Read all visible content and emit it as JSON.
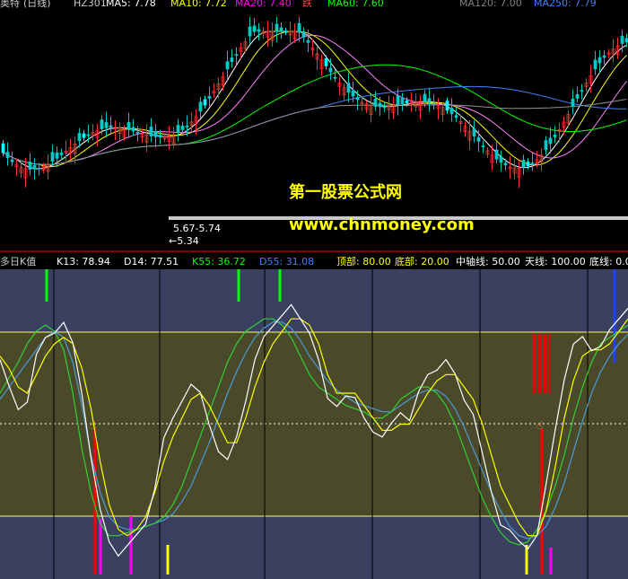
{
  "top_panel": {
    "stock_name": "奥特",
    "period": "(日线)",
    "code": "HZ301",
    "ma_label": "MA5: 7.78",
    "ma10_label": "MA10: 7.72",
    "ma20_label": "MA20: 7.40",
    "extra_label": "跌",
    "ma60_label": "MA60: 7.60",
    "ma120_label": "MA120: 7.00",
    "ma250_label": "MA250: 7.79",
    "annotation_range": "5.67-5.74",
    "annotation_low": "←5.34",
    "watermark_title": "第一股票公式网",
    "watermark_url": "www.chnmoney.com"
  },
  "bottom_panel": {
    "indicator_name": "多日K值",
    "k13": "K13: 78.94",
    "d14": "D14: 77.51",
    "k55": "K55: 36.72",
    "d55": "D55: 31.08",
    "top_label": "顶部: 80.00",
    "bottom_label": "底部: 20.00",
    "mid_label": "中轴线: 50.00",
    "sky_label": "天线: 100.00",
    "floor_label": "底线: 0.0"
  },
  "colors": {
    "up": "#ff3030",
    "down": "#00ffff",
    "ma5": "#ffffff",
    "ma10": "#ffff00",
    "ma20": "#ff00ff",
    "ma60": "#00ff00",
    "ma120": "#4080ff",
    "ma250": "#808080",
    "band_fill": "#4a4a2a",
    "outer_fill": "#3a4060"
  },
  "chart_data": {
    "type": "line",
    "k13": [
      70,
      62,
      55,
      58,
      72,
      78,
      80,
      82,
      76,
      60,
      40,
      22,
      12,
      8,
      10,
      14,
      18,
      30,
      45,
      52,
      58,
      62,
      60,
      50,
      42,
      38,
      46,
      58,
      70,
      78,
      82,
      86,
      88,
      84,
      80,
      70,
      58,
      56,
      60,
      58,
      52,
      48,
      45,
      50,
      54,
      52,
      60,
      66,
      68,
      70,
      66,
      58,
      54,
      40,
      28,
      18,
      15,
      12,
      10,
      15,
      30,
      48,
      65,
      75,
      78,
      74,
      76,
      80,
      84,
      88
    ],
    "d14": [
      72,
      68,
      62,
      60,
      66,
      72,
      76,
      78,
      76,
      68,
      55,
      38,
      24,
      16,
      14,
      16,
      20,
      28,
      38,
      46,
      52,
      58,
      60,
      56,
      50,
      44,
      44,
      52,
      62,
      70,
      76,
      80,
      84,
      84,
      82,
      76,
      66,
      60,
      60,
      60,
      56,
      52,
      48,
      48,
      50,
      50,
      55,
      60,
      64,
      66,
      66,
      62,
      58,
      50,
      40,
      30,
      24,
      18,
      14,
      14,
      22,
      36,
      52,
      64,
      72,
      74,
      74,
      76,
      80,
      84
    ],
    "k55": [
      60,
      65,
      70,
      76,
      80,
      82,
      80,
      74,
      60,
      42,
      28,
      18,
      14,
      14,
      15,
      16,
      17,
      18,
      20,
      24,
      30,
      38,
      46,
      54,
      62,
      70,
      76,
      80,
      82,
      84,
      84,
      82,
      78,
      72,
      66,
      62,
      60,
      58,
      56,
      55,
      54,
      52,
      52,
      54,
      58,
      60,
      62,
      62,
      60,
      56,
      50,
      42,
      34,
      26,
      20,
      15,
      12,
      11,
      12,
      16,
      22,
      30,
      40,
      52,
      62,
      70,
      76,
      78,
      80,
      82
    ],
    "d55": [
      58,
      62,
      66,
      70,
      74,
      78,
      80,
      78,
      70,
      56,
      40,
      28,
      20,
      17,
      16,
      16,
      17,
      18,
      19,
      21,
      25,
      30,
      37,
      44,
      52,
      60,
      67,
      73,
      78,
      81,
      83,
      83,
      81,
      77,
      72,
      68,
      64,
      61,
      59,
      57,
      56,
      55,
      54,
      54,
      56,
      58,
      60,
      61,
      61,
      59,
      55,
      49,
      42,
      35,
      28,
      22,
      17,
      14,
      13,
      14,
      17,
      23,
      31,
      41,
      51,
      60,
      67,
      72,
      76,
      79
    ],
    "ylim": [
      0,
      100
    ],
    "top_line": 80,
    "bottom_line": 20,
    "mid_line": 50
  }
}
